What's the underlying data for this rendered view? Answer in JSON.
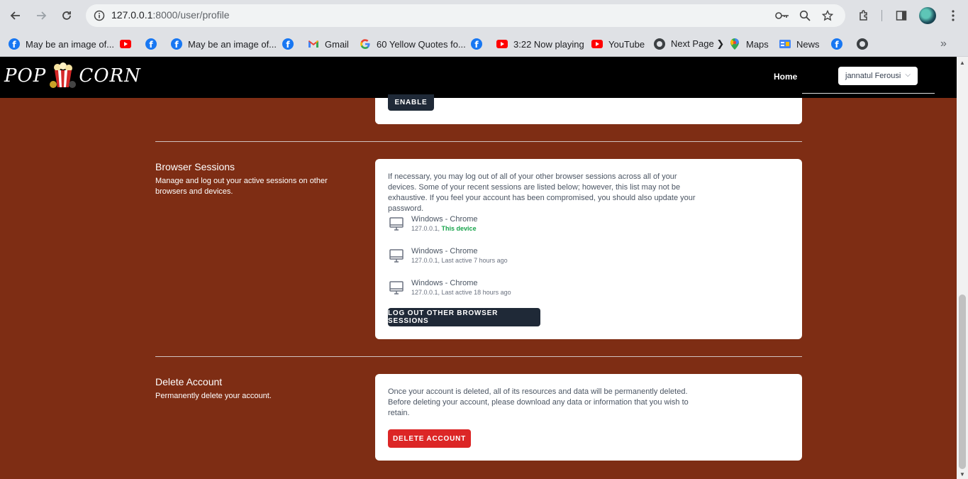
{
  "browser": {
    "url_host": "127.0.0.1",
    "url_rest": ":8000/user/profile",
    "bookmarks": [
      {
        "icon": "facebook-icon",
        "label": "May be an image of..."
      },
      {
        "icon": "youtube-icon",
        "label": ""
      },
      {
        "icon": "facebook-icon",
        "label": ""
      },
      {
        "icon": "facebook-icon",
        "label": "May be an image of..."
      },
      {
        "icon": "facebook-icon",
        "label": ""
      },
      {
        "icon": "gmail-icon",
        "label": "Gmail"
      },
      {
        "icon": "google-icon",
        "label": "60 Yellow Quotes fo..."
      },
      {
        "icon": "facebook-icon",
        "label": ""
      },
      {
        "icon": "youtube-icon",
        "label": "3:22 Now playing"
      },
      {
        "icon": "youtube-icon",
        "label": "YouTube"
      },
      {
        "icon": "globe-icon",
        "label": "Next Page ❯"
      },
      {
        "icon": "maps-icon",
        "label": "Maps"
      },
      {
        "icon": "news-icon",
        "label": "News"
      },
      {
        "icon": "facebook-icon",
        "label": ""
      },
      {
        "icon": "globe-icon",
        "label": ""
      }
    ],
    "overflow_glyph": "»"
  },
  "app": {
    "logo_left": "POP",
    "logo_right": "CORN",
    "nav_home": "Home",
    "user_name": "jannatul Ferousi",
    "chevron": "⌵"
  },
  "two_factor": {
    "enable_label": "ENABLE"
  },
  "sessions": {
    "title": "Browser Sessions",
    "description": "Manage and log out your active sessions on other browsers and devices.",
    "intro": "If necessary, you may log out of all of your other browser sessions across all of your devices. Some of your recent sessions are listed below; however, this list may not be exhaustive. If you feel your account has been compromised, you should also update your password.",
    "items": [
      {
        "name": "Windows - Chrome",
        "ip": "127.0.0.1, ",
        "status": "This device",
        "current": true
      },
      {
        "name": "Windows - Chrome",
        "ip": "127.0.0.1, ",
        "status": "Last active 7 hours ago",
        "current": false
      },
      {
        "name": "Windows - Chrome",
        "ip": "127.0.0.1, ",
        "status": "Last active 18 hours ago",
        "current": false
      }
    ],
    "logout_label": "LOG OUT OTHER BROWSER SESSIONS"
  },
  "delete_account": {
    "title": "Delete Account",
    "description": "Permanently delete your account.",
    "warning": "Once your account is deleted, all of its resources and data will be permanently deleted. Before deleting your account, please download any data or information that you wish to retain.",
    "button_label": "DELETE ACCOUNT"
  }
}
